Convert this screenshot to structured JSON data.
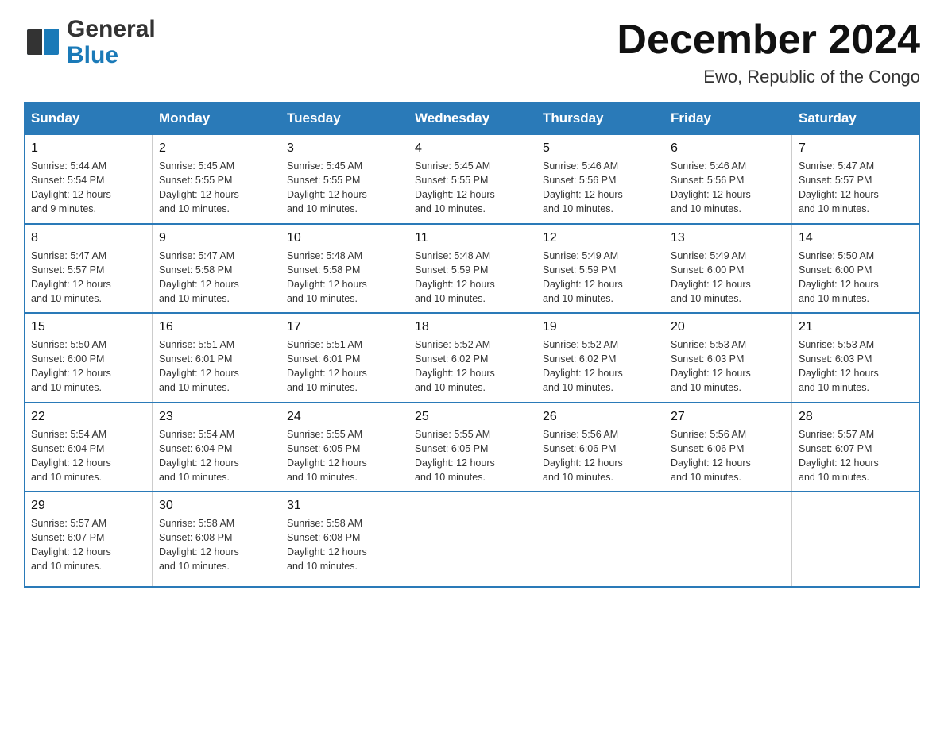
{
  "logo": {
    "text_general": "General",
    "text_blue": "Blue"
  },
  "title": "December 2024",
  "location": "Ewo, Republic of the Congo",
  "days_of_week": [
    "Sunday",
    "Monday",
    "Tuesday",
    "Wednesday",
    "Thursday",
    "Friday",
    "Saturday"
  ],
  "weeks": [
    [
      {
        "day": "1",
        "sunrise": "5:44 AM",
        "sunset": "5:54 PM",
        "daylight": "12 hours and 9 minutes."
      },
      {
        "day": "2",
        "sunrise": "5:45 AM",
        "sunset": "5:55 PM",
        "daylight": "12 hours and 10 minutes."
      },
      {
        "day": "3",
        "sunrise": "5:45 AM",
        "sunset": "5:55 PM",
        "daylight": "12 hours and 10 minutes."
      },
      {
        "day": "4",
        "sunrise": "5:45 AM",
        "sunset": "5:55 PM",
        "daylight": "12 hours and 10 minutes."
      },
      {
        "day": "5",
        "sunrise": "5:46 AM",
        "sunset": "5:56 PM",
        "daylight": "12 hours and 10 minutes."
      },
      {
        "day": "6",
        "sunrise": "5:46 AM",
        "sunset": "5:56 PM",
        "daylight": "12 hours and 10 minutes."
      },
      {
        "day": "7",
        "sunrise": "5:47 AM",
        "sunset": "5:57 PM",
        "daylight": "12 hours and 10 minutes."
      }
    ],
    [
      {
        "day": "8",
        "sunrise": "5:47 AM",
        "sunset": "5:57 PM",
        "daylight": "12 hours and 10 minutes."
      },
      {
        "day": "9",
        "sunrise": "5:47 AM",
        "sunset": "5:58 PM",
        "daylight": "12 hours and 10 minutes."
      },
      {
        "day": "10",
        "sunrise": "5:48 AM",
        "sunset": "5:58 PM",
        "daylight": "12 hours and 10 minutes."
      },
      {
        "day": "11",
        "sunrise": "5:48 AM",
        "sunset": "5:59 PM",
        "daylight": "12 hours and 10 minutes."
      },
      {
        "day": "12",
        "sunrise": "5:49 AM",
        "sunset": "5:59 PM",
        "daylight": "12 hours and 10 minutes."
      },
      {
        "day": "13",
        "sunrise": "5:49 AM",
        "sunset": "6:00 PM",
        "daylight": "12 hours and 10 minutes."
      },
      {
        "day": "14",
        "sunrise": "5:50 AM",
        "sunset": "6:00 PM",
        "daylight": "12 hours and 10 minutes."
      }
    ],
    [
      {
        "day": "15",
        "sunrise": "5:50 AM",
        "sunset": "6:00 PM",
        "daylight": "12 hours and 10 minutes."
      },
      {
        "day": "16",
        "sunrise": "5:51 AM",
        "sunset": "6:01 PM",
        "daylight": "12 hours and 10 minutes."
      },
      {
        "day": "17",
        "sunrise": "5:51 AM",
        "sunset": "6:01 PM",
        "daylight": "12 hours and 10 minutes."
      },
      {
        "day": "18",
        "sunrise": "5:52 AM",
        "sunset": "6:02 PM",
        "daylight": "12 hours and 10 minutes."
      },
      {
        "day": "19",
        "sunrise": "5:52 AM",
        "sunset": "6:02 PM",
        "daylight": "12 hours and 10 minutes."
      },
      {
        "day": "20",
        "sunrise": "5:53 AM",
        "sunset": "6:03 PM",
        "daylight": "12 hours and 10 minutes."
      },
      {
        "day": "21",
        "sunrise": "5:53 AM",
        "sunset": "6:03 PM",
        "daylight": "12 hours and 10 minutes."
      }
    ],
    [
      {
        "day": "22",
        "sunrise": "5:54 AM",
        "sunset": "6:04 PM",
        "daylight": "12 hours and 10 minutes."
      },
      {
        "day": "23",
        "sunrise": "5:54 AM",
        "sunset": "6:04 PM",
        "daylight": "12 hours and 10 minutes."
      },
      {
        "day": "24",
        "sunrise": "5:55 AM",
        "sunset": "6:05 PM",
        "daylight": "12 hours and 10 minutes."
      },
      {
        "day": "25",
        "sunrise": "5:55 AM",
        "sunset": "6:05 PM",
        "daylight": "12 hours and 10 minutes."
      },
      {
        "day": "26",
        "sunrise": "5:56 AM",
        "sunset": "6:06 PM",
        "daylight": "12 hours and 10 minutes."
      },
      {
        "day": "27",
        "sunrise": "5:56 AM",
        "sunset": "6:06 PM",
        "daylight": "12 hours and 10 minutes."
      },
      {
        "day": "28",
        "sunrise": "5:57 AM",
        "sunset": "6:07 PM",
        "daylight": "12 hours and 10 minutes."
      }
    ],
    [
      {
        "day": "29",
        "sunrise": "5:57 AM",
        "sunset": "6:07 PM",
        "daylight": "12 hours and 10 minutes."
      },
      {
        "day": "30",
        "sunrise": "5:58 AM",
        "sunset": "6:08 PM",
        "daylight": "12 hours and 10 minutes."
      },
      {
        "day": "31",
        "sunrise": "5:58 AM",
        "sunset": "6:08 PM",
        "daylight": "12 hours and 10 minutes."
      },
      null,
      null,
      null,
      null
    ]
  ],
  "labels": {
    "sunrise": "Sunrise:",
    "sunset": "Sunset:",
    "daylight": "Daylight:"
  },
  "colors": {
    "header_bg": "#2a7ab8",
    "header_text": "#ffffff",
    "border": "#2a7ab8"
  }
}
